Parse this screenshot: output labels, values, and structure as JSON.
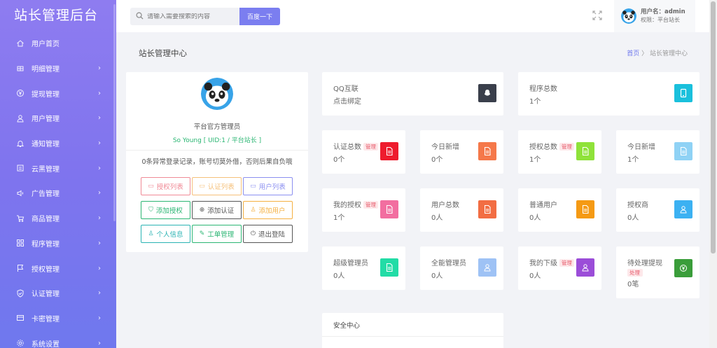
{
  "brand": "站长管理后台",
  "sidebar": {
    "items": [
      {
        "label": "用户首页",
        "icon": "home-icon",
        "arrow": false
      },
      {
        "label": "明细管理",
        "icon": "list-icon",
        "arrow": true
      },
      {
        "label": "提现管理",
        "icon": "yen-icon",
        "arrow": true
      },
      {
        "label": "用户管理",
        "icon": "user-icon",
        "arrow": true
      },
      {
        "label": "通知管理",
        "icon": "bell-icon",
        "arrow": true
      },
      {
        "label": "云黑管理",
        "icon": "grid-icon",
        "arrow": true
      },
      {
        "label": "广告管理",
        "icon": "speaker-icon",
        "arrow": true
      },
      {
        "label": "商品管理",
        "icon": "cart-icon",
        "arrow": true
      },
      {
        "label": "程序管理",
        "icon": "apps-icon",
        "arrow": true
      },
      {
        "label": "授权管理",
        "icon": "flag-icon",
        "arrow": true
      },
      {
        "label": "认证管理",
        "icon": "shield-icon",
        "arrow": true
      },
      {
        "label": "卡密管理",
        "icon": "card-icon",
        "arrow": true
      },
      {
        "label": "系统设置",
        "icon": "gear-icon",
        "arrow": true
      }
    ]
  },
  "header": {
    "search_placeholder": "请输入需要搜索的内容",
    "search_button": "百度一下",
    "user_name": "用户名：admin",
    "user_role": "权限：平台站长"
  },
  "page": {
    "title": "站长管理中心",
    "breadcrumb_home": "首页",
    "breadcrumb_sep": "〉",
    "breadcrumb_current": "站长管理中心"
  },
  "profile": {
    "role": "平台官方管理员",
    "uid_line": "So Young [ UID:1 / 平台站长 ]",
    "notice": "0条异常登录记录，账号切莫外借，否则后果自负哦",
    "buttons": [
      {
        "label": "授权列表",
        "color": "#f08a96"
      },
      {
        "label": "认证列表",
        "color": "#f5c07a"
      },
      {
        "label": "用户列表",
        "color": "#8b8ff0"
      },
      {
        "label": "添加授权",
        "color": "#2bb673"
      },
      {
        "label": "添加认证",
        "color": "#555555"
      },
      {
        "label": "添加用户",
        "color": "#f5b041"
      },
      {
        "label": "个人信息",
        "color": "#2ab3b3"
      },
      {
        "label": "工单管理",
        "color": "#2bb673"
      },
      {
        "label": "退出登陆",
        "color": "#555555"
      }
    ]
  },
  "stats": [
    {
      "title": "QQ互联",
      "value": "点击绑定",
      "tag": "",
      "color": "#3a3f4b",
      "icon": "qq-icon"
    },
    {
      "title": "程序总数",
      "value": "1个",
      "tag": "",
      "color": "#1ac0dc",
      "icon": "phone-icon"
    },
    {
      "title": "认证总数",
      "value": "0个",
      "tag": "管理",
      "color": "#ee1c2e",
      "icon": "doc-icon"
    },
    {
      "title": "今日新增",
      "value": "0个",
      "tag": "",
      "color": "#f5784a",
      "icon": "doc-icon"
    },
    {
      "title": "授权总数",
      "value": "1个",
      "tag": "管理",
      "color": "#8fe23a",
      "icon": "doc-icon"
    },
    {
      "title": "今日新增",
      "value": "1个",
      "tag": "",
      "color": "#8fd2f5",
      "icon": "doc-icon"
    },
    {
      "title": "我的授权",
      "value": "1个",
      "tag": "管理",
      "color": "#f26ea0",
      "icon": "doc-icon"
    },
    {
      "title": "用户总数",
      "value": "0人",
      "tag": "",
      "color": "#f26d43",
      "icon": "doc-icon"
    },
    {
      "title": "普通用户",
      "value": "0人",
      "tag": "",
      "color": "#f59a14",
      "icon": "doc-icon"
    },
    {
      "title": "授权商",
      "value": "0人",
      "tag": "",
      "color": "#3cb1f2",
      "icon": "user-icon"
    },
    {
      "title": "超级管理员",
      "value": "0人",
      "tag": "",
      "color": "#22dca6",
      "icon": "doc-icon"
    },
    {
      "title": "全能管理员",
      "value": "0人",
      "tag": "",
      "color": "#9ec2f5",
      "icon": "user-icon"
    },
    {
      "title": "我的下级",
      "value": "0人",
      "tag": "管理",
      "color": "#9b4dd8",
      "icon": "user-icon"
    },
    {
      "title": "待处理提现",
      "value": "0笔",
      "tag": "处理",
      "color": "#3a9d3a",
      "icon": "yen-icon"
    }
  ],
  "security": {
    "title": "安全中心"
  }
}
